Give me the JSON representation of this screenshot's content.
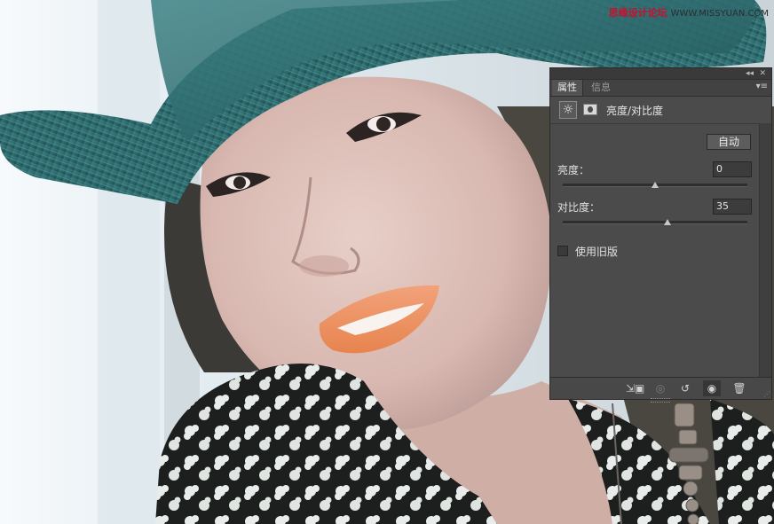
{
  "watermark": {
    "cn": "思缘设计论坛",
    "en": "WWW.MISSYUAN.COM"
  },
  "panel": {
    "tabs": [
      {
        "label": "属性",
        "active": true
      },
      {
        "label": "信息",
        "active": false
      }
    ],
    "header_title": "亮度/对比度",
    "auto_button": "自动",
    "brightness": {
      "label": "亮度：",
      "value": "0",
      "slider": 0,
      "min": -150,
      "max": 150
    },
    "contrast": {
      "label": "对比度：",
      "value": "35",
      "slider": 35,
      "min": -50,
      "max": 100
    },
    "legacy": {
      "label": "使用旧版",
      "checked": false
    },
    "footer_icons": [
      "clip-to-layer-icon",
      "view-previous-icon",
      "reset-icon",
      "visibility-eye-icon",
      "trash-icon"
    ]
  },
  "colors": {
    "panel_bg": "#4b4b4b",
    "hat": "#2e6a6c",
    "lips": "#f0956a"
  }
}
